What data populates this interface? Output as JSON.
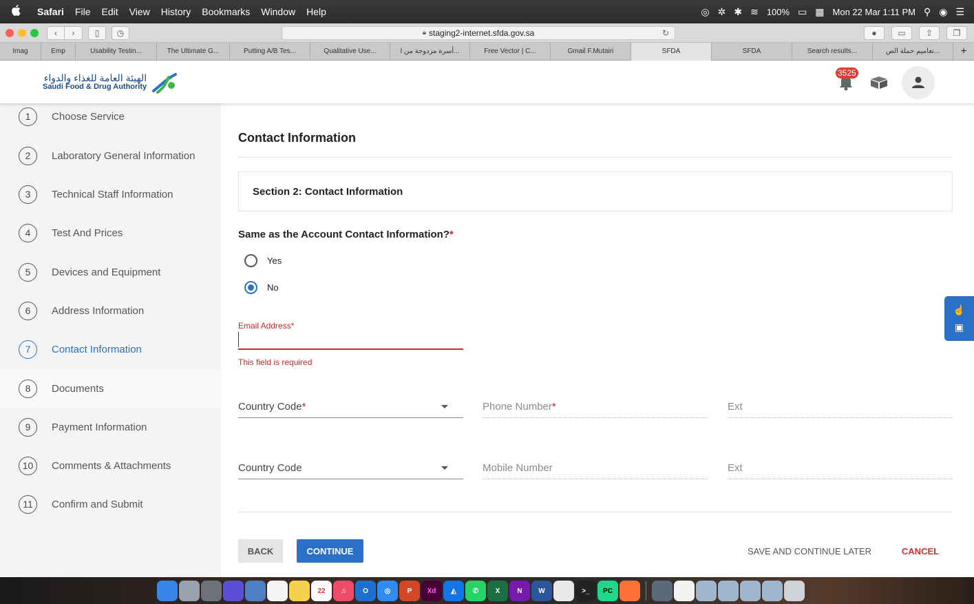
{
  "menubar": {
    "apple": "",
    "items": [
      "Safari",
      "File",
      "Edit",
      "View",
      "History",
      "Bookmarks",
      "Window",
      "Help"
    ],
    "battery": "100%",
    "datetime": "Mon 22 Mar  1:11 PM"
  },
  "browser": {
    "url": "staging2-internet.sfda.gov.sa",
    "tabs": [
      "Imag",
      "Emp",
      "Usability Testin...",
      "The Ultimate G...",
      "Putting A/B Tes...",
      "Qualitative Use...",
      "أسرة مزدوجة من ا...",
      "Free Vector | C...",
      "Gmail F.Mutairi",
      "SFDA",
      "SFDA",
      "Search results...",
      "تعاميم حملة الص..."
    ],
    "active_tab_index": 9
  },
  "header": {
    "logo_ar": "الهيئة العامة للغذاء والدواء",
    "logo_en": "Saudi Food & Drug Authority",
    "notification_count": "3525"
  },
  "sidebar": {
    "steps": [
      {
        "num": "1",
        "label": "Choose Service"
      },
      {
        "num": "2",
        "label": "Laboratory General Information"
      },
      {
        "num": "3",
        "label": "Technical Staff Information"
      },
      {
        "num": "4",
        "label": "Test And Prices"
      },
      {
        "num": "5",
        "label": "Devices and Equipment"
      },
      {
        "num": "6",
        "label": "Address Information"
      },
      {
        "num": "7",
        "label": "Contact Information"
      },
      {
        "num": "8",
        "label": "Documents"
      },
      {
        "num": "9",
        "label": "Payment Information"
      },
      {
        "num": "10",
        "label": "Comments & Attachments"
      },
      {
        "num": "11",
        "label": "Confirm and Submit"
      }
    ],
    "active_index": 6
  },
  "main": {
    "title": "Contact Information",
    "section_title": "Section 2: Contact Information",
    "question": "Same as the Account Contact Information?",
    "required_mark": "*",
    "options": {
      "yes": "Yes",
      "no": "No"
    },
    "selected_option": "No",
    "email": {
      "label": "Email Address*",
      "value": "",
      "error": "This field is required"
    },
    "phone_row": {
      "country_code": "Country Code",
      "phone": "Phone Number",
      "ext": "Ext"
    },
    "mobile_row": {
      "country_code": "Country Code",
      "mobile": "Mobile Number",
      "ext": "Ext"
    }
  },
  "actions": {
    "back": "BACK",
    "continue": "CONTINUE",
    "save_later": "SAVE AND CONTINUE LATER",
    "cancel": "CANCEL"
  },
  "colors": {
    "primary": "#2a70c9",
    "error": "#c62828",
    "sidebar_bg": "#f4f4f4"
  }
}
